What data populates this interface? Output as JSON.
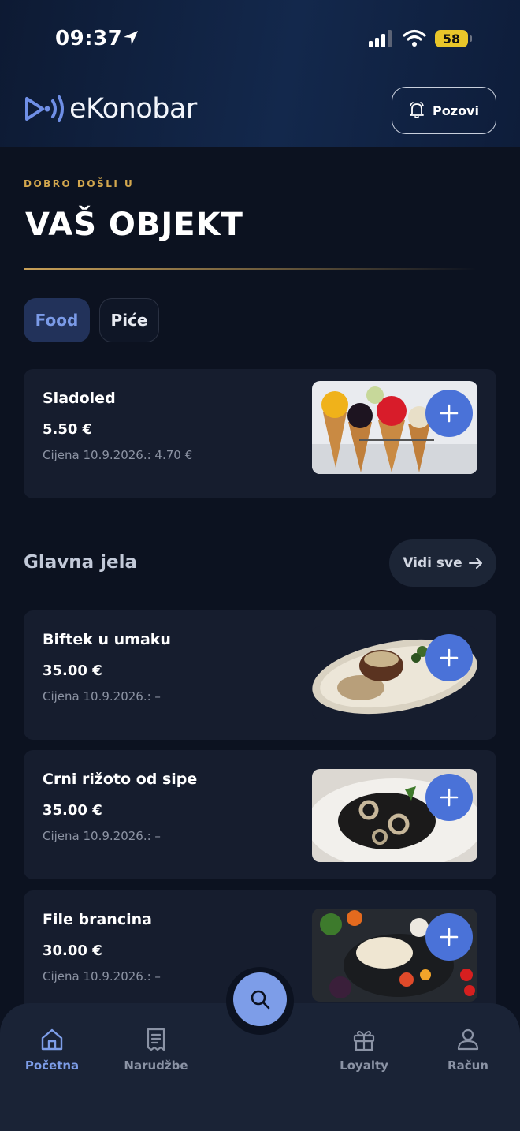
{
  "status_bar": {
    "time": "09:37",
    "battery": "58"
  },
  "header": {
    "brand": "eKonobar",
    "call_button": "Pozovi"
  },
  "welcome": {
    "subtitle": "DOBRO DOŠLI U",
    "title": "VAŠ OBJEKT"
  },
  "tabs": [
    {
      "label": "Food",
      "active": true
    },
    {
      "label": "Piće",
      "active": false
    }
  ],
  "featured_item": {
    "name": "Sladoled",
    "price": "5.50 €",
    "old_price": "Cijena 10.9.2026.: 4.70 €"
  },
  "section": {
    "title": "Glavna jela",
    "see_all": "Vidi sve"
  },
  "items": [
    {
      "name": "Biftek u umaku",
      "price": "35.00 €",
      "old_price": "Cijena 10.9.2026.: –"
    },
    {
      "name": "Crni rižoto od sipe",
      "price": "35.00 €",
      "old_price": "Cijena 10.9.2026.: –"
    },
    {
      "name": "File brancina",
      "price": "30.00 €",
      "old_price": "Cijena 10.9.2026.: –"
    }
  ],
  "bottom_nav": [
    {
      "label": "Početna",
      "icon": "home-icon",
      "active": true
    },
    {
      "label": "Narudžbe",
      "icon": "receipt-icon",
      "active": false
    },
    {
      "label": "Loyalty",
      "icon": "gift-icon",
      "active": false
    },
    {
      "label": "Račun",
      "icon": "user-icon",
      "active": false
    }
  ],
  "colors": {
    "accent": "#7d9de8",
    "add_button": "#4a72d8",
    "gold": "#d3a74e",
    "background": "#0c1220",
    "card": "#161d2e"
  }
}
